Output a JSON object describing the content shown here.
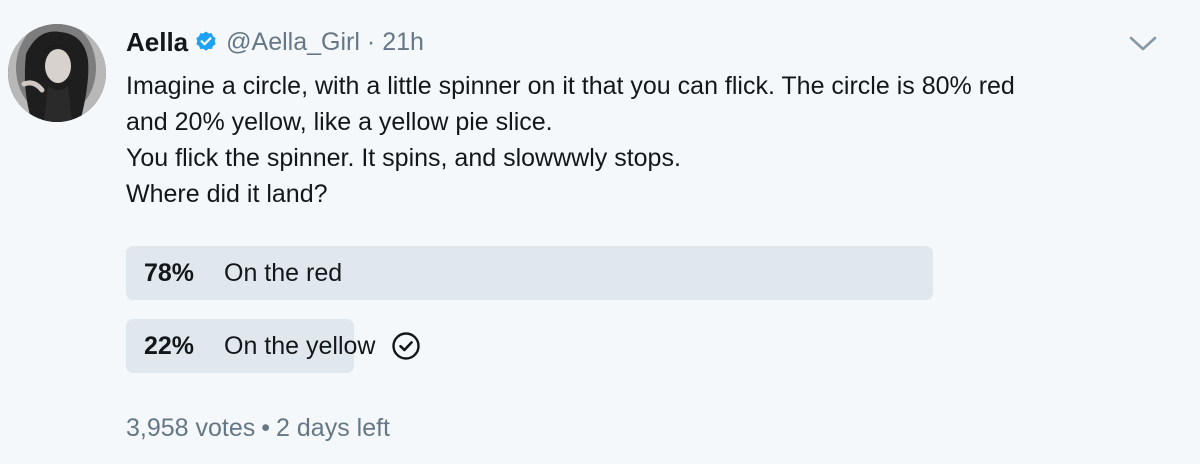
{
  "tweet": {
    "author_name": "Aella",
    "handle": "@Aella_Girl",
    "separator": "·",
    "time": "21h",
    "lines": [
      "Imagine a circle, with a little spinner on it that you can flick. The circle is 80% red",
      "and 20% yellow, like a yellow pie slice.",
      "You flick the spinner. It spins, and slowwwly stops.",
      "Where did it land?"
    ]
  },
  "poll": {
    "options": [
      {
        "percent_label": "78%",
        "percent": 78,
        "label": "On the red",
        "selected": false
      },
      {
        "percent_label": "22%",
        "percent": 22,
        "label": "On the yellow",
        "selected": true
      }
    ],
    "votes": "3,958 votes",
    "bullet": "•",
    "time_left": "2 days left"
  },
  "colors": {
    "verified": "#1da1f2",
    "muted": "#657786",
    "bar": "#e1e8ed",
    "background": "#f5f8fa",
    "text": "#14171a"
  },
  "icons": {
    "verified": "verified-badge-icon",
    "menu": "chevron-down-icon",
    "selected": "checkmark-circle-icon"
  }
}
